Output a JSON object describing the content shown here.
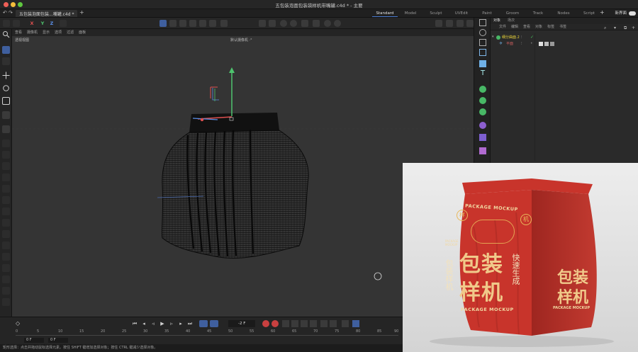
{
  "window": {
    "title": "五包装泡面包装袋样机带嘴罐.c4d * - 主要"
  },
  "document_tab": {
    "label": "五包装泡面包装...嘴罐.c4d *",
    "add_tab": "+"
  },
  "layouts": [
    {
      "label": "Standard",
      "active": true
    },
    {
      "label": "Model"
    },
    {
      "label": "Sculpt"
    },
    {
      "label": "UVEdit"
    },
    {
      "label": "Paint"
    },
    {
      "label": "Groom"
    },
    {
      "label": "Track"
    },
    {
      "label": "Nodes"
    },
    {
      "label": "Script"
    }
  ],
  "layout_add": "+",
  "new_layout": "新界面",
  "axis": {
    "x": "X",
    "y": "Y",
    "z": "Z"
  },
  "viewport": {
    "menu": [
      "查看",
      "摄像机",
      "显示",
      "选项",
      "过滤",
      "面板"
    ],
    "view_name": "透视视图",
    "camera_name": "默认摄像机 ·°"
  },
  "object_panel": {
    "tabs": [
      "对象",
      "场次"
    ],
    "menu": [
      "文件",
      "编辑",
      "查看",
      "对象",
      "标签",
      "书签"
    ],
    "objects": [
      {
        "name": "细分曲面.2",
        "color": "#e8d23a"
      },
      {
        "name": "平面",
        "color": "#d06060"
      }
    ]
  },
  "timeline": {
    "current_frame": "-2 F",
    "ruler_ticks": [
      "0",
      "5",
      "10",
      "15",
      "20",
      "25",
      "30",
      "35",
      "40",
      "45",
      "50",
      "55",
      "60",
      "65",
      "70",
      "75",
      "80",
      "85",
      "90"
    ],
    "start_frame": "0 F",
    "end_frame": "0 F"
  },
  "status": {
    "text": "矩形选择：点击并拖动鼠标选择元素。按住 SHIFT 键增加选择对象；按住 CTRL 键减少选择对象。"
  },
  "product": {
    "brand_en": "PACKAGE MOCKUP",
    "title_line1": "包装",
    "title_line2": "样机",
    "side_left": "包装样机",
    "side_right": "快速生成",
    "corner_left": "样",
    "corner_right": "机",
    "small_label": "PACKAGE MOCKUP",
    "bag_color": "#c8342b",
    "ink_color": "#e8b85a"
  },
  "colors": {
    "accent": "#4a7bd1",
    "axis_x": "#e05050",
    "axis_y": "#4ec46e",
    "axis_z": "#5a8ee6"
  }
}
